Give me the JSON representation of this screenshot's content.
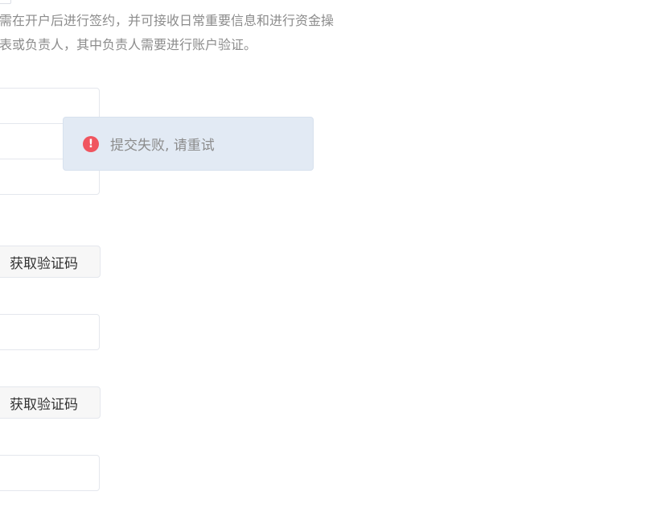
{
  "description": {
    "line1": "需在开户后进行签约，并可接收日常重要信息和进行资金操",
    "line2": "表或负责人，其中负责人需要进行账户验证。"
  },
  "form": {
    "get_code_button_1": "获取验证码",
    "get_code_button_2": "获取验证码"
  },
  "toast": {
    "icon": "error-icon",
    "message": "提交失败, 请重试",
    "icon_color": "#f0555f",
    "background_color": "#e2eaf4"
  }
}
